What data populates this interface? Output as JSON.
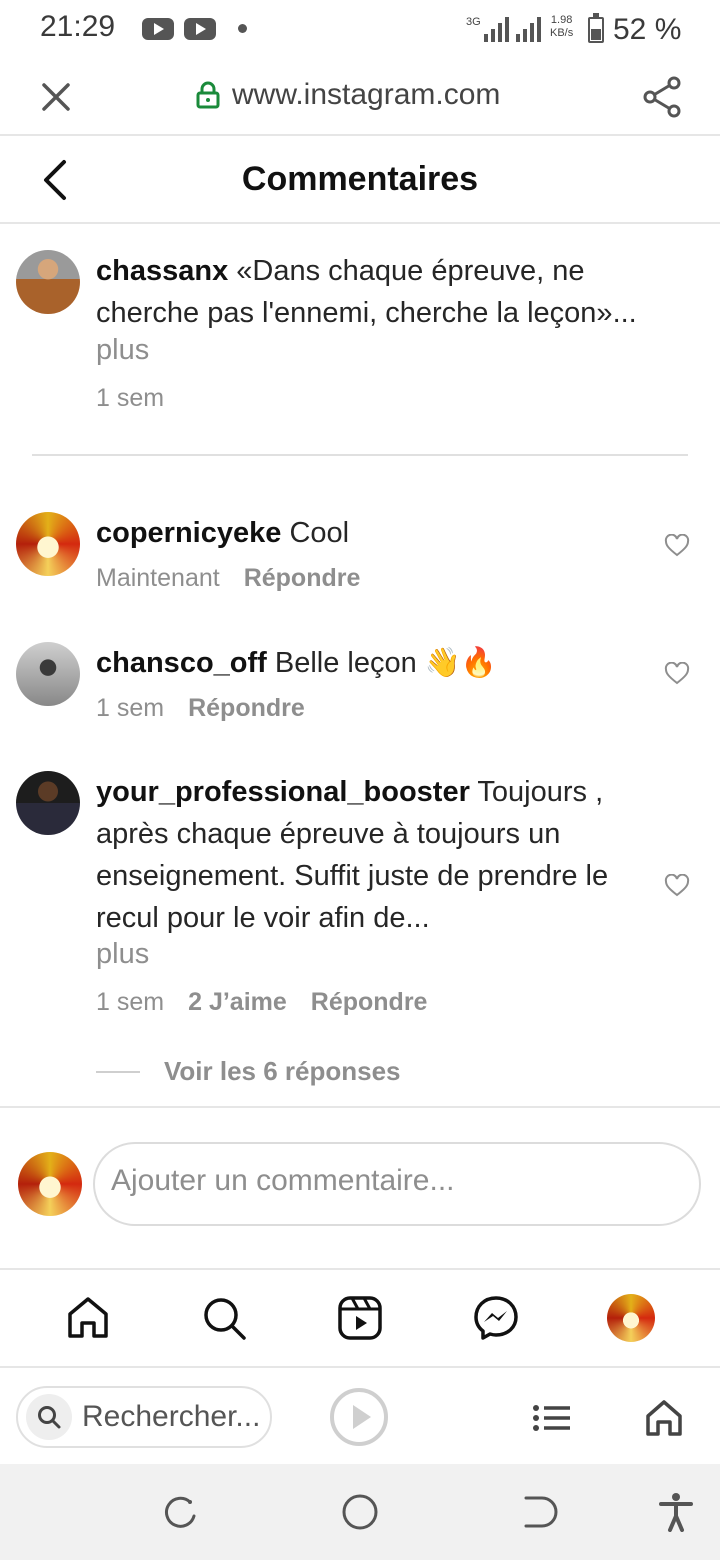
{
  "status_bar": {
    "time": "21:29",
    "network": "3G",
    "speed": "1.98",
    "speed_unit": "KB/s",
    "battery": "52 %",
    "battery_level": 0.52
  },
  "browser": {
    "url": "www.instagram.com",
    "search_placeholder": "Rechercher..."
  },
  "header": {
    "title": "Commentaires"
  },
  "caption": {
    "username": "chassanx",
    "text": "«Dans chaque épreuve, ne cherche pas l'ennemi, cherche la leçon»...",
    "more": "plus",
    "time": "1 sem"
  },
  "comments": [
    {
      "username": "copernicyeke",
      "text": "Cool",
      "time": "Maintenant",
      "reply": "Répondre"
    },
    {
      "username": "chansco_off",
      "text": "Belle leçon 👋🔥",
      "time": "1 sem",
      "reply": "Répondre"
    },
    {
      "username": "your_professional_booster",
      "text": "Toujours , après chaque épreuve à toujours un enseignement. Suffit juste de prendre le recul pour le voir afin de...",
      "more": "plus",
      "time": "1 sem",
      "likes": "2 J’aime",
      "reply": "Répondre",
      "view_replies": "Voir les 6 réponses"
    }
  ],
  "composer": {
    "placeholder": "Ajouter un commentaire..."
  },
  "colors": {
    "secure": "#1a8a3a",
    "text": "#262626",
    "muted": "#8e8e8e"
  }
}
